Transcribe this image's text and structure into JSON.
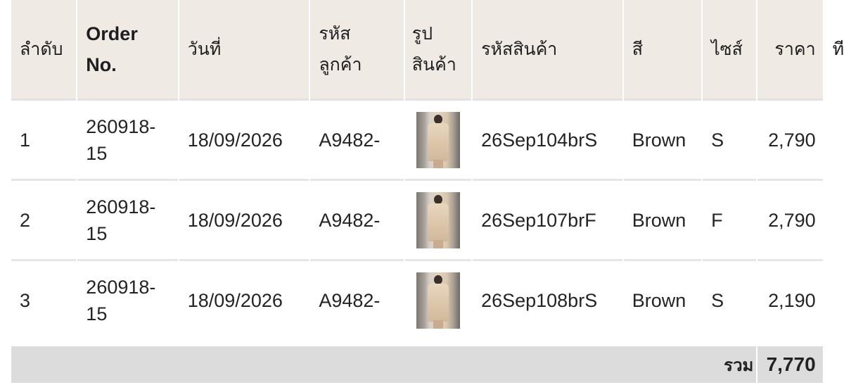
{
  "table": {
    "headers": {
      "no": "ลำดับ",
      "order_no": "Order No.",
      "date": "วันที่",
      "customer_code": "รหัส ลูกค้า",
      "product_image": "รูป สินค้า",
      "product_code": "รหัสสินค้า",
      "color": "สี",
      "size": "ไซส์",
      "price": "ราคา",
      "extra": "ที"
    },
    "rows": [
      {
        "no": "1",
        "order_no": "260918-15",
        "date": "18/09/2026",
        "customer_code": "A9482-",
        "product_image": "product-photo",
        "product_code": "26Sep104brS",
        "color": "Brown",
        "size": "S",
        "price": "2,790"
      },
      {
        "no": "2",
        "order_no": "260918-15",
        "date": "18/09/2026",
        "customer_code": "A9482-",
        "product_image": "product-photo",
        "product_code": "26Sep107brF",
        "color": "Brown",
        "size": "F",
        "price": "2,790"
      },
      {
        "no": "3",
        "order_no": "260918-15",
        "date": "18/09/2026",
        "customer_code": "A9482-",
        "product_image": "product-photo",
        "product_code": "26Sep108brS",
        "color": "Brown",
        "size": "S",
        "price": "2,190"
      }
    ],
    "footer": {
      "total_label": "รวม",
      "total_value": "7,770"
    }
  },
  "colors": {
    "header_bg": "#efebe4",
    "footer_bg": "#dcdcdc",
    "row_border": "#e6e6e6"
  }
}
